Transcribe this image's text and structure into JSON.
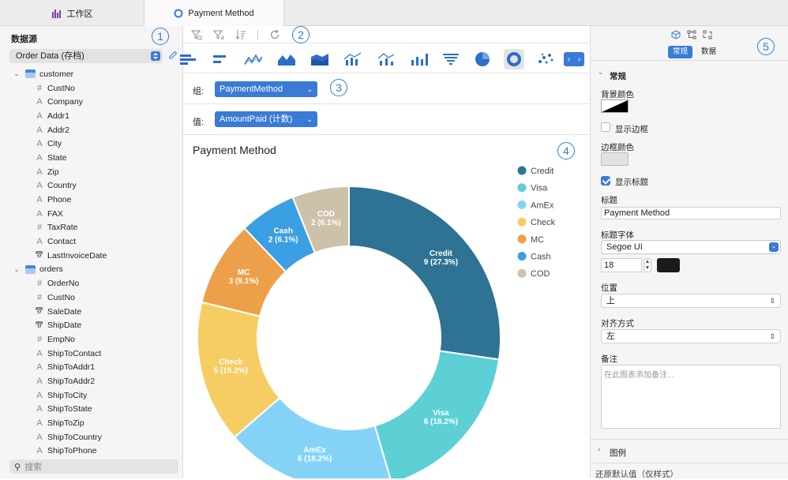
{
  "tabs": [
    {
      "label": "工作区",
      "icon": "bar-chart-icon"
    },
    {
      "label": "Payment Method",
      "icon": "donut-chart-icon"
    }
  ],
  "left_panel": {
    "title": "数据源",
    "datasource": "Order Data (存档)",
    "tables": [
      {
        "name": "customer",
        "fields": [
          {
            "name": "CustNo",
            "type": "#"
          },
          {
            "name": "Company",
            "type": "A"
          },
          {
            "name": "Addr1",
            "type": "A"
          },
          {
            "name": "Addr2",
            "type": "A"
          },
          {
            "name": "City",
            "type": "A"
          },
          {
            "name": "State",
            "type": "A"
          },
          {
            "name": "Zip",
            "type": "A"
          },
          {
            "name": "Country",
            "type": "A"
          },
          {
            "name": "Phone",
            "type": "A"
          },
          {
            "name": "FAX",
            "type": "A"
          },
          {
            "name": "TaxRate",
            "type": "#"
          },
          {
            "name": "Contact",
            "type": "A"
          },
          {
            "name": "LastInvoiceDate",
            "type": "date"
          }
        ]
      },
      {
        "name": "orders",
        "fields": [
          {
            "name": "OrderNo",
            "type": "#"
          },
          {
            "name": "CustNo",
            "type": "#"
          },
          {
            "name": "SaleDate",
            "type": "date"
          },
          {
            "name": "ShipDate",
            "type": "date"
          },
          {
            "name": "EmpNo",
            "type": "#"
          },
          {
            "name": "ShipToContact",
            "type": "A"
          },
          {
            "name": "ShipToAddr1",
            "type": "A"
          },
          {
            "name": "ShipToAddr2",
            "type": "A"
          },
          {
            "name": "ShipToCity",
            "type": "A"
          },
          {
            "name": "ShipToState",
            "type": "A"
          },
          {
            "name": "ShipToZip",
            "type": "A"
          },
          {
            "name": "ShipToCountry",
            "type": "A"
          },
          {
            "name": "ShipToPhone",
            "type": "A"
          }
        ]
      }
    ],
    "search_placeholder": "搜索"
  },
  "center": {
    "group_label": "组:",
    "group_value": "PaymentMethod",
    "value_label": "值:",
    "value_value": "AmountPaid (计数)"
  },
  "badges": [
    "1",
    "2",
    "3",
    "4",
    "5"
  ],
  "chart_data": {
    "type": "pie",
    "donut": true,
    "title": "Payment Method",
    "legend_position": "right",
    "slices": [
      {
        "label": "Credit",
        "value": 9,
        "percent": "27.3%",
        "color": "#2e7394"
      },
      {
        "label": "Visa",
        "value": 6,
        "percent": "18.2%",
        "color": "#5dd0d6"
      },
      {
        "label": "AmEx",
        "value": 6,
        "percent": "18.2%",
        "color": "#84d3f7"
      },
      {
        "label": "Check",
        "value": 5,
        "percent": "15.2%",
        "color": "#f5cd63"
      },
      {
        "label": "MC",
        "value": 3,
        "percent": "9.1%",
        "color": "#eda04a"
      },
      {
        "label": "Cash",
        "value": 2,
        "percent": "6.1%",
        "color": "#3b9fe3"
      },
      {
        "label": "COD",
        "value": 2,
        "percent": "6.1%",
        "color": "#cdc2a9"
      }
    ]
  },
  "right_panel": {
    "tab_general": "常规",
    "tab_data": "数据",
    "section_general": "常规",
    "bg_color_label": "背景颜色",
    "show_border_label": "显示边框",
    "show_border_checked": false,
    "border_color_label": "边框颜色",
    "show_title_label": "显示标题",
    "show_title_checked": true,
    "title_label": "标题",
    "title_value": "Payment Method",
    "title_font_label": "标题字体",
    "title_font_value": "Segoe UI",
    "title_font_size": "18",
    "title_font_color": "#1a1a1a",
    "position_label": "位置",
    "position_value": "上",
    "align_label": "对齐方式",
    "align_value": "左",
    "notes_label": "备注",
    "notes_placeholder": "在此图表添加备注...",
    "legend_section": "图例",
    "restore_defaults": "还原默认值（仅样式）"
  }
}
